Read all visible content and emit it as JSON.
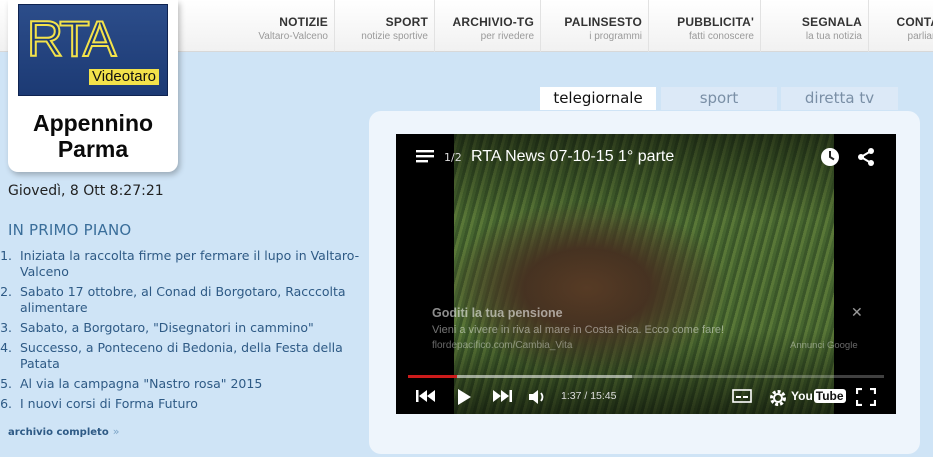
{
  "nav": {
    "items": [
      {
        "title": "NOTIZIE",
        "sub": "Valtaro-Valceno"
      },
      {
        "title": "SPORT",
        "sub": "notizie sportive"
      },
      {
        "title": "ARCHIVIO-TG",
        "sub": "per rivedere"
      },
      {
        "title": "PALINSESTO",
        "sub": "i programmi"
      },
      {
        "title": "PUBBLICITA'",
        "sub": "fatti conoscere"
      },
      {
        "title": "SEGNALA",
        "sub": "la tua notizia"
      },
      {
        "title": "CONTATTI",
        "sub": "parliamone"
      }
    ]
  },
  "logo": {
    "main": "RTA",
    "sub": "Videotaro"
  },
  "region": {
    "line1": "Appennino",
    "line2": "Parma"
  },
  "datetime": "Giovedì, 8 Ott 8:27:21",
  "primo_piano": {
    "title": "IN PRIMO PIANO",
    "items": [
      {
        "n": "1.",
        "text": "Iniziata la raccolta firme per fermare il lupo in Valtaro-Valceno"
      },
      {
        "n": "2.",
        "text": "Sabato 17 ottobre, al Conad di Borgotaro, Racccolta alimentare"
      },
      {
        "n": "3.",
        "text": "Sabato, a Borgotaro, \"Disegnatori in cammino\""
      },
      {
        "n": "4.",
        "text": "Successo, a Ponteceno di Bedonia, della Festa della Patata"
      },
      {
        "n": "5.",
        "text": "Al via la campagna \"Nastro rosa\" 2015"
      },
      {
        "n": "6.",
        "text": "I nuovi corsi di Forma Futuro"
      }
    ],
    "archive": "archivio completo",
    "archive_chevron": "»"
  },
  "tabs": [
    {
      "label": "telegiornale",
      "active": true
    },
    {
      "label": "sport",
      "active": false
    },
    {
      "label": "diretta tv",
      "active": false
    }
  ],
  "player": {
    "playlist_count": "1/2",
    "title": "RTA News 07-10-15 1° parte",
    "ad": {
      "title": "Goditi la tua pensione",
      "desc": "Vieni a vivere in riva al mare in Costa Rica. Ecco come fare!",
      "url": "flordepacifico.com/Cambia_Vita",
      "close": "✕",
      "label": "Annunci Google"
    },
    "time": "1:37 / 15:45",
    "progress": 0.103,
    "buffered": 0.47,
    "youtube": {
      "you": "You",
      "tube": "Tube"
    },
    "accent": "#cc1b1b"
  },
  "colors": {
    "page_bg": "#cfe4f6",
    "link": "#2e5a85",
    "section": "#3a6e9a"
  }
}
